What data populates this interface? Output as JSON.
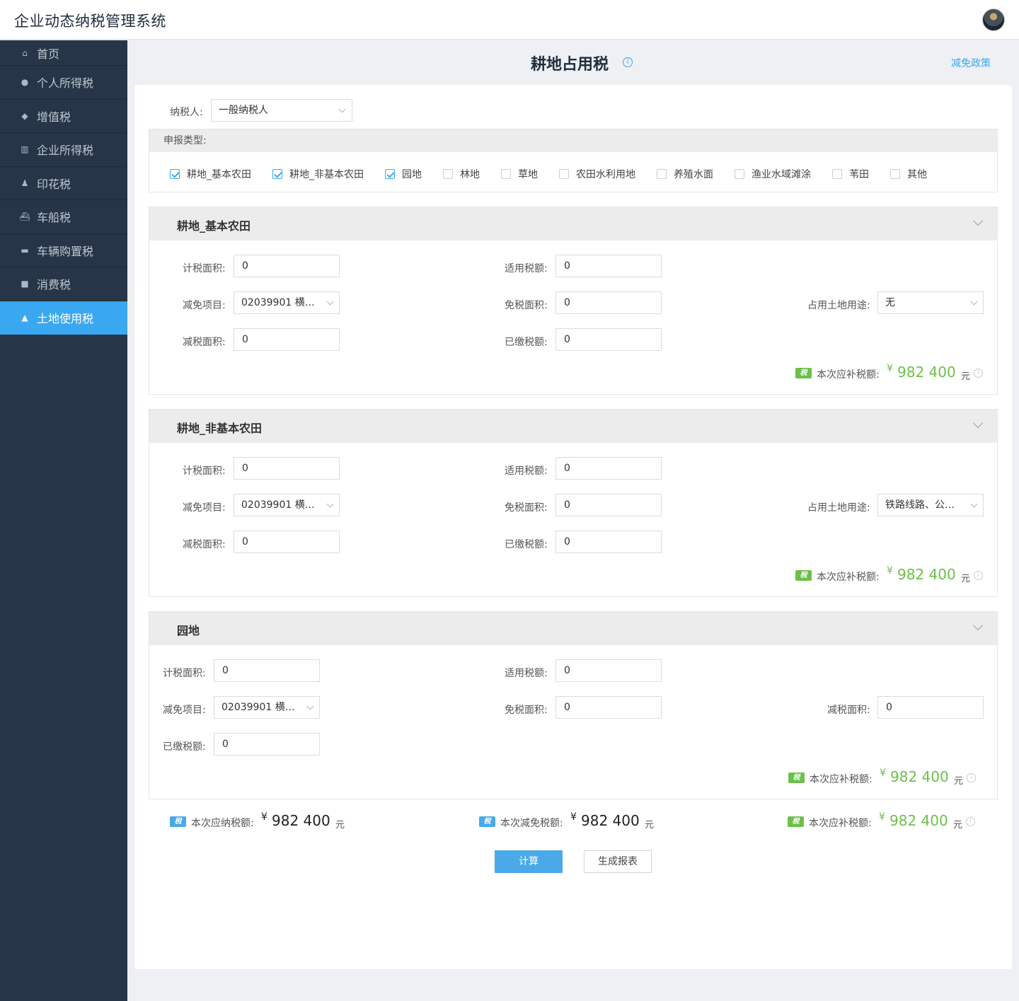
{
  "app": {
    "title": "企业动态纳税管理系统"
  },
  "sidebar": {
    "items": [
      {
        "label": "首页",
        "icon": "home-icon"
      },
      {
        "label": "个人所得税",
        "icon": "person-icon"
      },
      {
        "label": "增值税",
        "icon": "diamond-icon"
      },
      {
        "label": "企业所得税",
        "icon": "factory-icon"
      },
      {
        "label": "印花税",
        "icon": "stamp-icon"
      },
      {
        "label": "车船税",
        "icon": "boat-icon"
      },
      {
        "label": "车辆购置税",
        "icon": "car-icon"
      },
      {
        "label": "消费税",
        "icon": "bag-icon"
      },
      {
        "label": "土地使用税",
        "icon": "land-icon",
        "active": true
      }
    ]
  },
  "page": {
    "title": "耕地占用税",
    "policy_link": "减免政策"
  },
  "form": {
    "taxpayer_label": "纳税人:",
    "taxpayer_value": "一般纳税人",
    "declare_type_label": "申报类型:",
    "declare_types": [
      {
        "label": "耕地_基本农田",
        "checked": true
      },
      {
        "label": "耕地_非基本农田",
        "checked": true
      },
      {
        "label": "园地",
        "checked": true
      },
      {
        "label": "林地",
        "checked": false
      },
      {
        "label": "草地",
        "checked": false
      },
      {
        "label": "农田水利用地",
        "checked": false
      },
      {
        "label": "养殖水面",
        "checked": false
      },
      {
        "label": "渔业水域滩涂",
        "checked": false
      },
      {
        "label": "苇田",
        "checked": false
      },
      {
        "label": "其他",
        "checked": false
      }
    ]
  },
  "labels": {
    "taxable_area": "计税面积:",
    "applicable_rate": "适用税额:",
    "exemption_item": "减免项目:",
    "exempt_area": "免税面积:",
    "land_use": "占用土地用途:",
    "reduced_area": "减税面积:",
    "paid_tax": "已缴税额:",
    "supplement": "本次应补税额:",
    "payable": "本次应纳税额:",
    "reduction": "本次减免税额:",
    "currency": "¥",
    "unit": "元",
    "tax_badge": "税"
  },
  "sections": [
    {
      "title": "耕地_基本农田",
      "taxable_area": "0",
      "applicable_rate": "0",
      "exemption_item": "02039901 横琴 ...",
      "exempt_area": "0",
      "land_use": "无",
      "reduced_area": "0",
      "paid_tax": "0",
      "supplement": "982 400"
    },
    {
      "title": "耕地_非基本农田",
      "taxable_area": "0",
      "applicable_rate": "0",
      "exemption_item": "02039901 横琴 ...",
      "exempt_area": "0",
      "land_use": "铁路线路、公路...",
      "reduced_area": "0",
      "paid_tax": "0",
      "supplement": "982 400"
    },
    {
      "title": "园地",
      "taxable_area": "0",
      "applicable_rate": "0",
      "exemption_item": "02039901 横琴 ...",
      "exempt_area": "0",
      "reduced_area": "0",
      "paid_tax": "0",
      "supplement": "982 400"
    }
  ],
  "totals": {
    "payable": "982 400",
    "reduction": "982 400",
    "supplement": "982 400"
  },
  "buttons": {
    "calculate": "计算",
    "report": "生成报表"
  },
  "colors": {
    "accent": "#3aa8f0",
    "sidebar_bg": "#263547",
    "money_green": "#6cc04a"
  }
}
